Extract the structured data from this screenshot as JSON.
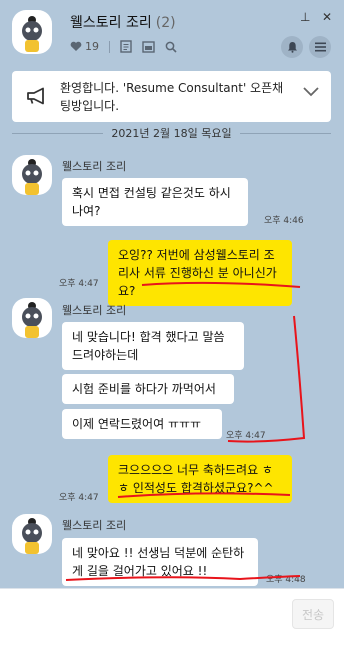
{
  "window": {
    "pin": "⊥",
    "close": "✕"
  },
  "header": {
    "title": "웰스토리 조리",
    "member_count": "(2)",
    "likes": "19"
  },
  "notice": {
    "text": "환영합니다. 'Resume Consultant' 오픈채팅방입니다."
  },
  "date_separator": "2021년 2월 18일 목요일",
  "messages": [
    {
      "sender": "웰스토리 조리",
      "text": "혹시 면접 컨설팅 같은것도 하시나여?",
      "time": "오후 4:46"
    },
    {
      "mine": true,
      "text": "오잉?? 저번에 삼성웰스토리 조리사 서류 진행하신 분 아니신가요?",
      "time": "오후 4:47"
    },
    {
      "sender": "웰스토리 조리",
      "text": "네 맞습니다! 합격 했다고 말씀 드려야하는데",
      "time": ""
    },
    {
      "text": "시험 준비를 하다가 까먹어서",
      "time": ""
    },
    {
      "text": "이제 연락드렸어여 ㅠㅠㅠ",
      "time": "오후 4:47"
    },
    {
      "mine": true,
      "text": "크으으으으 너무 축하드려요 ㅎㅎ 인적성도 합격하셨군요?^^",
      "time": "오후 4:47"
    },
    {
      "sender": "웰스토리 조리",
      "text": "네 맞아요 !! 선생님 덕분에 순탄하게 길을 걸어가고 있어요 !!",
      "time": "오후 4:48"
    }
  ],
  "compose": {
    "send_label": "전송"
  },
  "colors": {
    "background": "#b2c7da",
    "my_bubble": "#fee500",
    "their_bubble": "#ffffff",
    "annotation": "#e8141b"
  }
}
